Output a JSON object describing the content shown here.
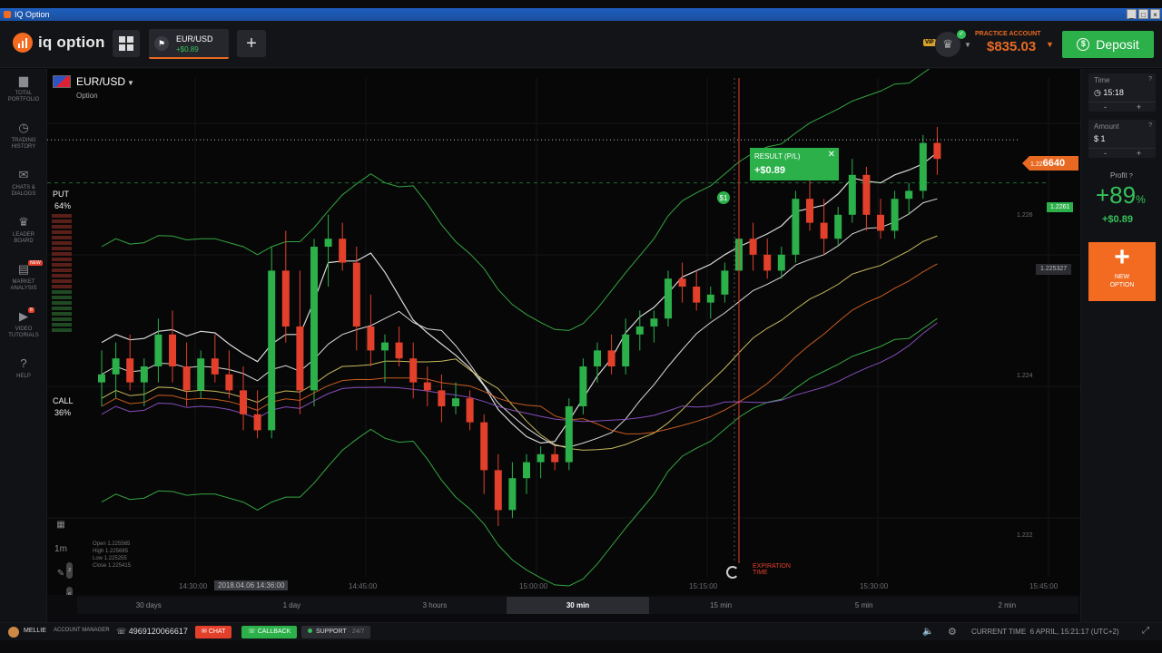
{
  "window": {
    "title": "IQ Option",
    "buttons": [
      "_",
      "□",
      "×"
    ]
  },
  "header": {
    "logo_text": "iq option",
    "asset_tab": {
      "name": "EUR/USD",
      "profit": "+$0.89"
    },
    "plus": "+",
    "vip": "VIP",
    "account_label": "PRACTICE ACCOUNT",
    "balance": "$835.03",
    "deposit": "Deposit",
    "deposit_icon": "$"
  },
  "sidebar": {
    "items": [
      {
        "icon": "briefcase-icon",
        "glyph": "▆",
        "label1": "TOTAL",
        "label2": "PORTFOLIO"
      },
      {
        "icon": "history-icon",
        "glyph": "◷",
        "label1": "TRADING",
        "label2": "HISTORY"
      },
      {
        "icon": "chat-icon",
        "glyph": "✉",
        "label1": "CHATS &",
        "label2": "DIALOGS"
      },
      {
        "icon": "trophy-icon",
        "glyph": "♛",
        "label1": "LEADER",
        "label2": "BOARD"
      },
      {
        "icon": "analysis-icon",
        "glyph": "▤",
        "label1": "MARKET",
        "label2": "ANALYSIS",
        "badge": "NEW"
      },
      {
        "icon": "video-icon",
        "glyph": "▶",
        "label1": "VIDEO",
        "label2": "TUTORIALS",
        "badge": "8"
      },
      {
        "icon": "help-icon",
        "glyph": "?",
        "label1": "HELP",
        "label2": ""
      }
    ]
  },
  "chart": {
    "asset": "EUR/USD",
    "asset_type": "Option",
    "put_label": "PUT",
    "put_pct": "64%",
    "call_label": "CALL",
    "call_pct": "36%",
    "result_label": "RESULT (P/L)",
    "result_value": "+$0.89",
    "current_price": "1.22",
    "current_price_big": "6640",
    "open_price": "1.2261",
    "hover_price": "1.225327",
    "y_labels": [
      "1.226",
      "1.224",
      "1.222"
    ],
    "time_labels": [
      "14:30:00",
      "14:45:00",
      "15:00:00",
      "15:15:00",
      "15:30:00",
      "15:45:00"
    ],
    "highlight_time": "2018.04.06 14:36:00",
    "expiration_line1": "EXPIRATION",
    "expiration_line2": "TIME",
    "bubble": "$1",
    "ohlc": {
      "open": "Open  1.225565",
      "high": "High  1.225685",
      "low": "Low  1.225255",
      "close": "Close  1.225415"
    },
    "tools": {
      "interval": "1m",
      "draw_badge": "2",
      "indicator_badge": "6"
    },
    "colors": {
      "up": "#2bb04a",
      "down": "#e3402b",
      "accent": "#e86a22"
    }
  },
  "chart_data": {
    "type": "candlestick",
    "title": "EUR/USD",
    "ylim": [
      1.2213,
      1.2273
    ],
    "x_start": "14:06",
    "interval": "1m",
    "candles": [
      {
        "t": "14:06",
        "o": 1.2236,
        "h": 1.224,
        "l": 1.2233,
        "c": 1.2237
      },
      {
        "t": "14:07",
        "o": 1.2237,
        "h": 1.2241,
        "l": 1.2234,
        "c": 1.2239
      },
      {
        "t": "14:08",
        "o": 1.2239,
        "h": 1.2242,
        "l": 1.2235,
        "c": 1.2236
      },
      {
        "t": "14:09",
        "o": 1.2236,
        "h": 1.2239,
        "l": 1.2233,
        "c": 1.2238
      },
      {
        "t": "14:10",
        "o": 1.2238,
        "h": 1.2244,
        "l": 1.2236,
        "c": 1.2242
      },
      {
        "t": "14:11",
        "o": 1.2242,
        "h": 1.2245,
        "l": 1.2236,
        "c": 1.2238
      },
      {
        "t": "14:12",
        "o": 1.2238,
        "h": 1.2241,
        "l": 1.2233,
        "c": 1.2235
      },
      {
        "t": "14:13",
        "o": 1.2235,
        "h": 1.224,
        "l": 1.2234,
        "c": 1.2239
      },
      {
        "t": "14:14",
        "o": 1.2239,
        "h": 1.2242,
        "l": 1.2236,
        "c": 1.2237
      },
      {
        "t": "14:15",
        "o": 1.2237,
        "h": 1.224,
        "l": 1.2234,
        "c": 1.2235
      },
      {
        "t": "14:16",
        "o": 1.2235,
        "h": 1.2238,
        "l": 1.223,
        "c": 1.2232
      },
      {
        "t": "14:17",
        "o": 1.2232,
        "h": 1.2235,
        "l": 1.2229,
        "c": 1.223
      },
      {
        "t": "14:18",
        "o": 1.223,
        "h": 1.2253,
        "l": 1.2229,
        "c": 1.225
      },
      {
        "t": "14:19",
        "o": 1.225,
        "h": 1.2255,
        "l": 1.2241,
        "c": 1.2243
      },
      {
        "t": "14:20",
        "o": 1.2243,
        "h": 1.225,
        "l": 1.2232,
        "c": 1.2235
      },
      {
        "t": "14:21",
        "o": 1.2235,
        "h": 1.2254,
        "l": 1.2233,
        "c": 1.2253
      },
      {
        "t": "14:22",
        "o": 1.2253,
        "h": 1.2257,
        "l": 1.2248,
        "c": 1.2254
      },
      {
        "t": "14:23",
        "o": 1.2254,
        "h": 1.2256,
        "l": 1.225,
        "c": 1.2251
      },
      {
        "t": "14:24",
        "o": 1.2251,
        "h": 1.2253,
        "l": 1.224,
        "c": 1.2243
      },
      {
        "t": "14:25",
        "o": 1.2243,
        "h": 1.2247,
        "l": 1.2238,
        "c": 1.224
      },
      {
        "t": "14:26",
        "o": 1.224,
        "h": 1.2242,
        "l": 1.2236,
        "c": 1.2241
      },
      {
        "t": "14:27",
        "o": 1.2241,
        "h": 1.2243,
        "l": 1.2238,
        "c": 1.2239
      },
      {
        "t": "14:28",
        "o": 1.2239,
        "h": 1.2241,
        "l": 1.2234,
        "c": 1.2236
      },
      {
        "t": "14:29",
        "o": 1.2236,
        "h": 1.2238,
        "l": 1.2233,
        "c": 1.2235
      },
      {
        "t": "14:30",
        "o": 1.2235,
        "h": 1.2237,
        "l": 1.2231,
        "c": 1.2233
      },
      {
        "t": "14:31",
        "o": 1.2233,
        "h": 1.2236,
        "l": 1.2232,
        "c": 1.2234
      },
      {
        "t": "14:32",
        "o": 1.2234,
        "h": 1.2235,
        "l": 1.223,
        "c": 1.2231
      },
      {
        "t": "14:33",
        "o": 1.2231,
        "h": 1.2232,
        "l": 1.2222,
        "c": 1.2225
      },
      {
        "t": "14:34",
        "o": 1.2225,
        "h": 1.2227,
        "l": 1.2218,
        "c": 1.222
      },
      {
        "t": "14:35",
        "o": 1.222,
        "h": 1.2226,
        "l": 1.2219,
        "c": 1.2224
      },
      {
        "t": "14:36",
        "o": 1.2224,
        "h": 1.2227,
        "l": 1.2222,
        "c": 1.2226
      },
      {
        "t": "14:37",
        "o": 1.2226,
        "h": 1.2228,
        "l": 1.2224,
        "c": 1.2227
      },
      {
        "t": "14:38",
        "o": 1.2227,
        "h": 1.2228,
        "l": 1.2225,
        "c": 1.2226
      },
      {
        "t": "14:39",
        "o": 1.2226,
        "h": 1.2234,
        "l": 1.2225,
        "c": 1.2233
      },
      {
        "t": "14:40",
        "o": 1.2233,
        "h": 1.2239,
        "l": 1.2232,
        "c": 1.2238
      },
      {
        "t": "14:41",
        "o": 1.2238,
        "h": 1.2241,
        "l": 1.2236,
        "c": 1.224
      },
      {
        "t": "14:42",
        "o": 1.224,
        "h": 1.2242,
        "l": 1.2237,
        "c": 1.2238
      },
      {
        "t": "14:43",
        "o": 1.2238,
        "h": 1.2244,
        "l": 1.2237,
        "c": 1.2242
      },
      {
        "t": "14:44",
        "o": 1.2242,
        "h": 1.2245,
        "l": 1.224,
        "c": 1.2243
      },
      {
        "t": "14:45",
        "o": 1.2243,
        "h": 1.2245,
        "l": 1.2241,
        "c": 1.2244
      },
      {
        "t": "14:46",
        "o": 1.2244,
        "h": 1.225,
        "l": 1.2243,
        "c": 1.2249
      },
      {
        "t": "14:47",
        "o": 1.2249,
        "h": 1.2251,
        "l": 1.2246,
        "c": 1.2248
      },
      {
        "t": "14:48",
        "o": 1.2248,
        "h": 1.225,
        "l": 1.2245,
        "c": 1.2246
      },
      {
        "t": "14:49",
        "o": 1.2246,
        "h": 1.2248,
        "l": 1.2244,
        "c": 1.2247
      },
      {
        "t": "14:50",
        "o": 1.2247,
        "h": 1.2251,
        "l": 1.2246,
        "c": 1.225
      },
      {
        "t": "14:51",
        "o": 1.225,
        "h": 1.2255,
        "l": 1.2249,
        "c": 1.2254
      },
      {
        "t": "14:52",
        "o": 1.2254,
        "h": 1.2256,
        "l": 1.225,
        "c": 1.2252
      },
      {
        "t": "14:53",
        "o": 1.2252,
        "h": 1.2254,
        "l": 1.2249,
        "c": 1.225
      },
      {
        "t": "14:54",
        "o": 1.225,
        "h": 1.2253,
        "l": 1.2249,
        "c": 1.2252
      },
      {
        "t": "14:55",
        "o": 1.2252,
        "h": 1.226,
        "l": 1.2251,
        "c": 1.2259
      },
      {
        "t": "14:56",
        "o": 1.2259,
        "h": 1.2262,
        "l": 1.2255,
        "c": 1.2256
      },
      {
        "t": "14:57",
        "o": 1.2256,
        "h": 1.2259,
        "l": 1.2252,
        "c": 1.2254
      },
      {
        "t": "14:58",
        "o": 1.2254,
        "h": 1.2258,
        "l": 1.2253,
        "c": 1.2257
      },
      {
        "t": "14:59",
        "o": 1.2257,
        "h": 1.2264,
        "l": 1.2256,
        "c": 1.2262
      },
      {
        "t": "15:00",
        "o": 1.2262,
        "h": 1.2263,
        "l": 1.2255,
        "c": 1.2257
      },
      {
        "t": "15:01",
        "o": 1.2257,
        "h": 1.2259,
        "l": 1.2254,
        "c": 1.2255
      },
      {
        "t": "15:02",
        "o": 1.2255,
        "h": 1.226,
        "l": 1.2254,
        "c": 1.2259
      },
      {
        "t": "15:03",
        "o": 1.2259,
        "h": 1.2261,
        "l": 1.2257,
        "c": 1.226
      },
      {
        "t": "15:04",
        "o": 1.226,
        "h": 1.2267,
        "l": 1.2259,
        "c": 1.2266
      },
      {
        "t": "15:05",
        "o": 1.2266,
        "h": 1.2268,
        "l": 1.2262,
        "c": 1.2264
      }
    ],
    "open_price": 1.2261,
    "current_price": 1.22664
  },
  "timeframes": [
    "30 days",
    "1 day",
    "3 hours",
    "30 min",
    "15 min",
    "5 min",
    "2 min"
  ],
  "active_timeframe": "30 min",
  "right_panel": {
    "time_label": "Time",
    "time_value": "15:18",
    "amount_label": "Amount",
    "amount_value": "$ 1",
    "minus": "-",
    "plus": "+",
    "help": "?",
    "profit_label": "Profit",
    "profit_pct": "+89",
    "pct_sign": "%",
    "profit_value": "+$0.89",
    "new_option_line1": "NEW",
    "new_option_line2": "OPTION"
  },
  "footer": {
    "user": "MELLIE",
    "account_manager": "ACCOUNT MANAGER",
    "phone": "4969120066617",
    "chat": "CHAT",
    "callback": "CALLBACK",
    "support": "SUPPORT",
    "support_hours": "24/7",
    "current_time_label": "CURRENT TIME",
    "current_time": "6 APRIL, 15:21:17 (UTC+2)"
  }
}
